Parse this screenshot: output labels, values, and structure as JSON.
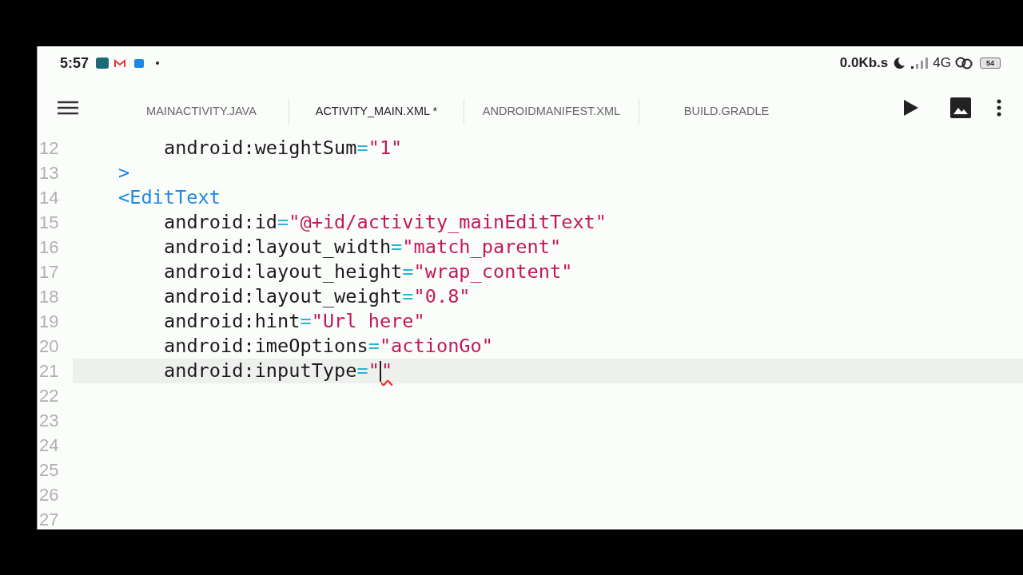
{
  "status_bar": {
    "time": "5:57",
    "network_speed": "0.0Kb.s",
    "network_type": "4G",
    "battery": "54"
  },
  "tabs": [
    {
      "label": "MAINACTIVITY.JAVA",
      "selected": false
    },
    {
      "label": "ACTIVITY_MAIN.XML *",
      "selected": true
    },
    {
      "label": "ANDROIDMANIFEST.XML",
      "selected": false
    },
    {
      "label": "BUILD.GRADLE",
      "selected": false
    }
  ],
  "editor": {
    "lines": [
      {
        "number": "12",
        "kind": "attribute",
        "current": false,
        "tokens": [
          {
            "kind": "name",
            "text": "android:weightSum"
          },
          {
            "kind": "equals",
            "text": "="
          },
          {
            "kind": "string",
            "text": "\"1\""
          }
        ]
      },
      {
        "number": "13",
        "kind": "tag",
        "current": false,
        "tokens": [
          {
            "kind": "tag",
            "text": ">"
          }
        ]
      },
      {
        "number": "14",
        "kind": "tag",
        "current": false,
        "tokens": [
          {
            "kind": "tag",
            "text": "<EditText"
          }
        ]
      },
      {
        "number": "15",
        "kind": "attribute",
        "current": false,
        "tokens": [
          {
            "kind": "name",
            "text": "android:id"
          },
          {
            "kind": "equals",
            "text": "="
          },
          {
            "kind": "string",
            "text": "\"@+id/activity_mainEditText\""
          }
        ]
      },
      {
        "number": "16",
        "kind": "attribute",
        "current": false,
        "tokens": [
          {
            "kind": "name",
            "text": "android:layout_width"
          },
          {
            "kind": "equals",
            "text": "="
          },
          {
            "kind": "string",
            "text": "\"match_parent\""
          }
        ]
      },
      {
        "number": "17",
        "kind": "attribute",
        "current": false,
        "tokens": [
          {
            "kind": "name",
            "text": "android:layout_height"
          },
          {
            "kind": "equals",
            "text": "="
          },
          {
            "kind": "string",
            "text": "\"wrap_content\""
          }
        ]
      },
      {
        "number": "18",
        "kind": "attribute",
        "current": false,
        "tokens": [
          {
            "kind": "name",
            "text": "android:layout_weight"
          },
          {
            "kind": "equals",
            "text": "="
          },
          {
            "kind": "string",
            "text": "\"0.8\""
          }
        ]
      },
      {
        "number": "19",
        "kind": "attribute",
        "current": false,
        "tokens": [
          {
            "kind": "name",
            "text": "android:hint"
          },
          {
            "kind": "equals",
            "text": "="
          },
          {
            "kind": "string",
            "text": "\"Url here\""
          }
        ]
      },
      {
        "number": "20",
        "kind": "attribute",
        "current": false,
        "tokens": [
          {
            "kind": "name",
            "text": "android:imeOptions"
          },
          {
            "kind": "equals",
            "text": "="
          },
          {
            "kind": "string",
            "text": "\"actionGo\""
          }
        ]
      },
      {
        "number": "21",
        "kind": "attribute",
        "current": true,
        "tokens": [
          {
            "kind": "name",
            "text": "android:inputType"
          },
          {
            "kind": "equals",
            "text": "="
          },
          {
            "kind": "string",
            "text": "\""
          },
          {
            "kind": "cursor"
          },
          {
            "kind": "error",
            "text": "\""
          }
        ]
      },
      {
        "number": "22",
        "kind": "empty",
        "current": false
      },
      {
        "number": "23",
        "kind": "empty",
        "current": false
      },
      {
        "number": "24",
        "kind": "empty",
        "current": false
      },
      {
        "number": "25",
        "kind": "empty",
        "current": false
      },
      {
        "number": "26",
        "kind": "empty",
        "current": false
      },
      {
        "number": "27",
        "kind": "empty",
        "current": false
      }
    ]
  }
}
